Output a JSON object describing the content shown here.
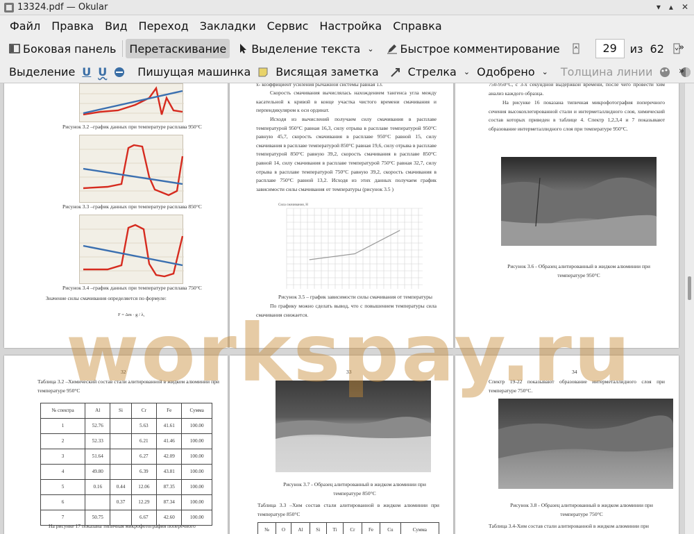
{
  "window": {
    "title": "13324.pdf — Okular"
  },
  "menu": [
    "Файл",
    "Правка",
    "Вид",
    "Переход",
    "Закладки",
    "Сервис",
    "Настройка",
    "Справка"
  ],
  "toolbar": {
    "sidebar": "Боковая панель",
    "drag": "Перетаскивание",
    "select_text": "Выделение текста",
    "quick_comment": "Быстрое комментирование",
    "page_current": "29",
    "page_of": "из",
    "page_total": "62"
  },
  "annot": {
    "selection": "Выделение",
    "typewriter": "Пишущая машинка",
    "sticky_note": "Висящая заметка",
    "arrow": "Стрелка",
    "approved": "Одобрено",
    "line_width": "Толщина линии"
  },
  "watermark": "workspay.ru",
  "pages": {
    "p1": {
      "cap1": "Рисунок 3.2 –график данных при температуре расплава 950°С",
      "cap2": "Рисунок 3.3 –график данных при температуре расплава 850°С",
      "cap3": "Рисунок 3.4 –график данных при температуре расплава 750°С",
      "formula_intro": "Значение силы смачивания определяется по формуле:",
      "formula": "F = Δm · g / λ,"
    },
    "p2": {
      "line0": "x- коэффициент усиления рычажной системы равная 13.",
      "para1": "Скорость смачивания вычислялась нахождением тангенса угла между касательной к кривой в конце участка чистого времени смачивания и перпендикуляром к оси ординат.",
      "para2": "Исходя из вычислений получаем силу смачивания в расплаве температурой 950°С равная 16,3, силу отрыва в расплаве температурой 950°С равную 45,7, скорость смачивания в расплаве 950°С равной 15, силу смачивания в расплаве температурой 850°С равная 19,6, силу отрыва в расплаве температурой 850°С равную 39,2, скорость смачивания в расплаве 850°С равной 14, силу смачивания в расплаве температурой 750°С равная 32,7, силу отрыва в расплаве температурой 750°С равную 39,2, скорость смачивания в расплаве 750°С равной 13,2. Исходя из этих данных получаем график зависимости силы смачивания от температуры (рисунок 3.5 )",
      "graph_title": "Сила смачивания, Н",
      "cap": "Рисунок 3.5 – график зависимости силы смачивания от температуры",
      "conclusion": "По графику можно сделать вывод, что с повышением температуры сила смачивания снижается."
    },
    "p3": {
      "line0": "750-950°С, с 3-х секундной выдержкой времени, после чего провести хим анализ каждого образца.",
      "para": "На рисунке 16 показана типичная микрофотография поперечного сечения высокохлегированной стали и интерметаллидного слоя, химический состав которых приведен в таблице 4. Спектр 1,2,3,4 и 7 показывают образование интерметаллидного слоя при температуре 950°С.",
      "cap": "Рисунок 3.6 - Образец алитированный в жидком алюминии при температуре 950°С"
    },
    "p4": {
      "num": "32",
      "title": "Таблица 3.2 –Химический состав стали алитированной в жидком алюминии при температуре 950°С",
      "headers": [
        "№ спектра",
        "Al",
        "Si",
        "Cr",
        "Fe",
        "Сумма"
      ],
      "rows": [
        [
          "1",
          "52.76",
          "",
          "5.63",
          "41.61",
          "100.00"
        ],
        [
          "2",
          "52.33",
          "",
          "6.21",
          "41.46",
          "100.00"
        ],
        [
          "3",
          "51.64",
          "",
          "6.27",
          "42.09",
          "100.00"
        ],
        [
          "4",
          "49.80",
          "",
          "6.39",
          "43.81",
          "100.00"
        ],
        [
          "5",
          "0.16",
          "0.44",
          "12.06",
          "87.35",
          "100.00"
        ],
        [
          "6",
          "",
          "0.37",
          "12.29",
          "87.34",
          "100.00"
        ],
        [
          "7",
          "50.75",
          "",
          "6.67",
          "42.60",
          "100.00"
        ]
      ],
      "bottom": "На рисунке 17 показана типичная микрофотография поперечного"
    },
    "p5": {
      "num": "33",
      "cap": "Рисунок 3.7 - Образец алитированный в жидком алюминии при температуре 850°С",
      "table_title": "Таблица 3.3 –Хим состав стали алитированной в жидком алюминии при температуре 850°С",
      "headers": [
        "№",
        "O",
        "Al",
        "Si",
        "Ti",
        "Cr",
        "Fe",
        "Cu",
        "Сумма"
      ]
    },
    "p6": {
      "num": "34",
      "text": "Спектр 19-22 показывают образование интерметаллидного слоя при температуре 750°С.",
      "cap": "Рисунок 3.8 - Образец алитированный в жидком алюминии при температуре 750°С",
      "bottom": "Таблица 3.4-Хим состав стали алитированной в жидком алюминии при"
    }
  },
  "chart_data": {
    "type": "line",
    "title": "Сила смачивания, Н",
    "x": [
      950,
      850,
      750
    ],
    "series": [
      {
        "values": [
          16.3,
          19.6,
          32.7
        ]
      }
    ]
  }
}
